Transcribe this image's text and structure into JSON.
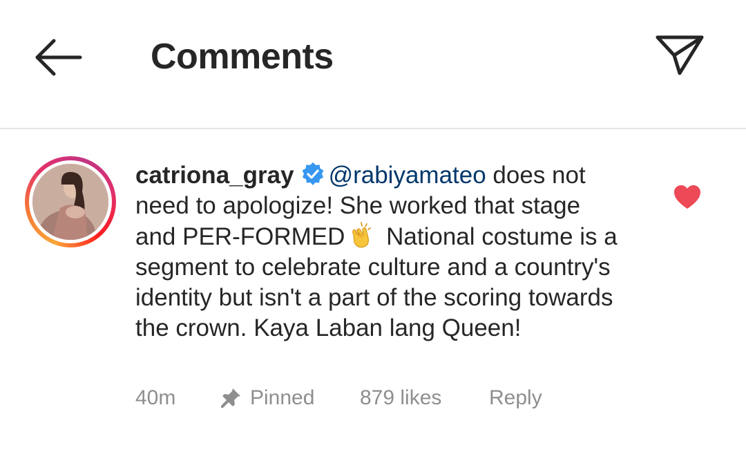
{
  "header": {
    "title": "Comments",
    "back_icon": "arrow-left-icon",
    "share_icon": "send-icon"
  },
  "comment": {
    "username": "catriona_gray",
    "verified": true,
    "mention": "@rabiyamateo",
    "text_part1": " does not need to apologize! She worked that stage and PER-FORMED",
    "emoji": "clapping-hands-icon",
    "text_part2": " National costume is a segment to celebrate culture and a country's identity but isn't a part of the scoring towards the crown. Kaya Laban lang Queen!",
    "time": "40m",
    "pinned_label": "Pinned",
    "likes": "879 likes",
    "reply_label": "Reply",
    "liked": true
  },
  "colors": {
    "heart": "#ed4956",
    "verified": "#3897f0",
    "mention": "#00376b",
    "meta": "#8e8e8e",
    "divider": "#e6e6e6"
  }
}
